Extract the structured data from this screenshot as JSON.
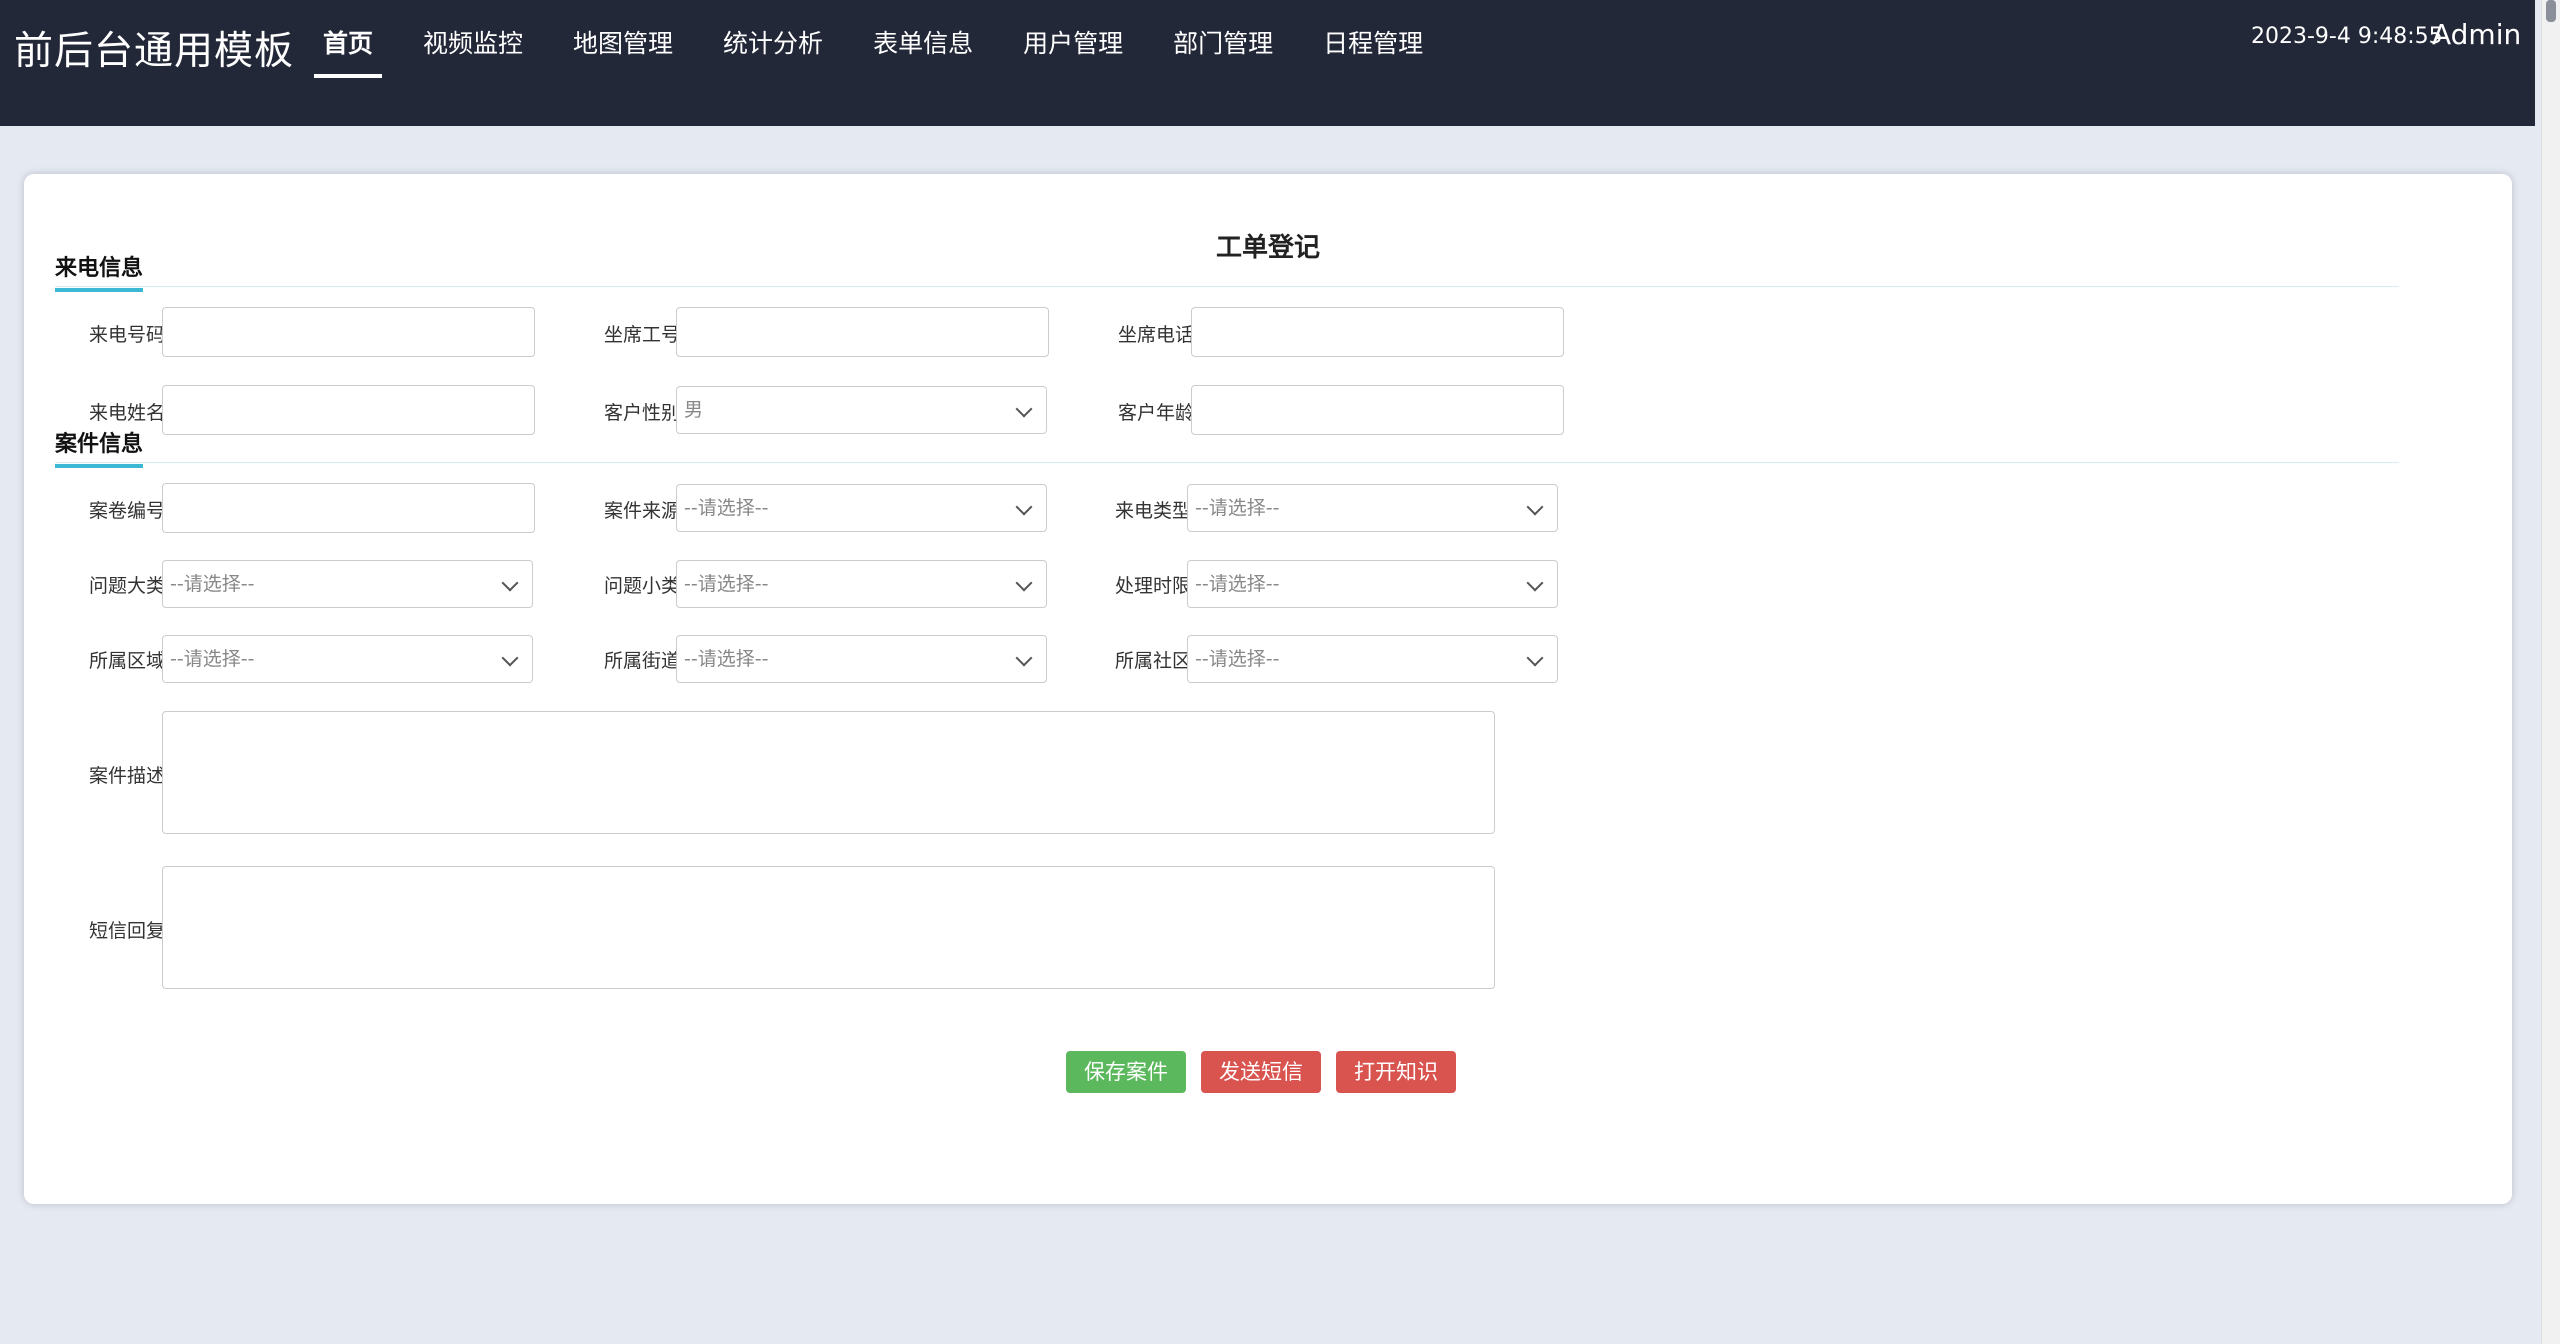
{
  "header": {
    "brand": "前后台通用模板",
    "nav": [
      "首页",
      "视频监控",
      "地图管理",
      "统计分析",
      "表单信息",
      "用户管理",
      "部门管理",
      "日程管理"
    ],
    "active_nav": "首页",
    "datetime": "2023-9-4 9:48:55",
    "user": "Admin"
  },
  "form": {
    "title": "工单登记",
    "section_call": "来电信息",
    "section_case": "案件信息",
    "fields": {
      "caller_number": "来电号码",
      "agent_id": "坐席工号",
      "agent_phone": "坐席电话",
      "caller_name": "来电姓名",
      "customer_gender": "客户性别",
      "customer_age": "客户年龄",
      "case_number": "案卷编号",
      "case_source": "案件来源",
      "call_type": "来电类型",
      "problem_category": "问题大类",
      "problem_subcategory": "问题小类",
      "deadline": "处理时限",
      "district": "所属区域",
      "street": "所属街道",
      "community": "所属社区",
      "case_description": "案件描述",
      "sms_reply": "短信回复"
    },
    "gender_value": "男",
    "select_placeholder": "--请选择--"
  },
  "buttons": {
    "save": "保存案件",
    "send_sms": "发送短信",
    "open_knowledge": "打开知识"
  },
  "colors": {
    "topbar": "#232838",
    "page_bg": "#e4e9f2",
    "accent": "#3db8d4",
    "btn_green": "#5cb85c",
    "btn_red": "#d9534f"
  }
}
